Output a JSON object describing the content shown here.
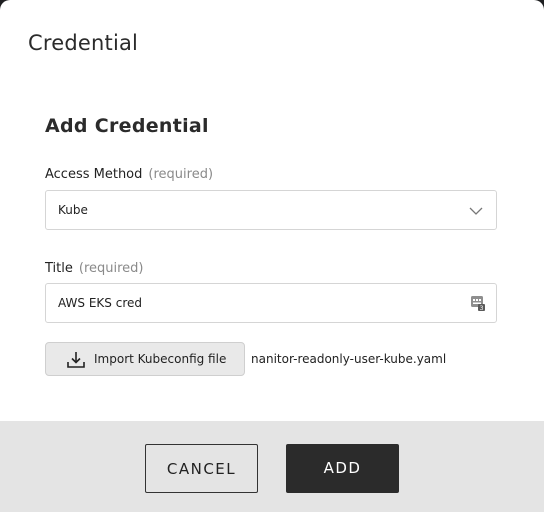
{
  "dialog": {
    "title": "Credential"
  },
  "form": {
    "section_title": "Add Credential",
    "access_method": {
      "label": "Access Method",
      "required_text": "(required)",
      "value": "Kube"
    },
    "title_field": {
      "label": "Title",
      "required_text": "(required)",
      "value": "AWS EKS cred"
    },
    "import": {
      "button_label": "Import Kubeconfig file",
      "filename": "nanitor-readonly-user-kube.yaml"
    }
  },
  "footer": {
    "cancel_label": "CANCEL",
    "add_label": "ADD"
  },
  "colors": {
    "primary_button": "#2b2b2b",
    "footer_bg": "#e4e4e4",
    "required_text": "#8a8a8a"
  },
  "icons": [
    "chevron-down-icon",
    "password-manager-icon",
    "download-icon"
  ]
}
